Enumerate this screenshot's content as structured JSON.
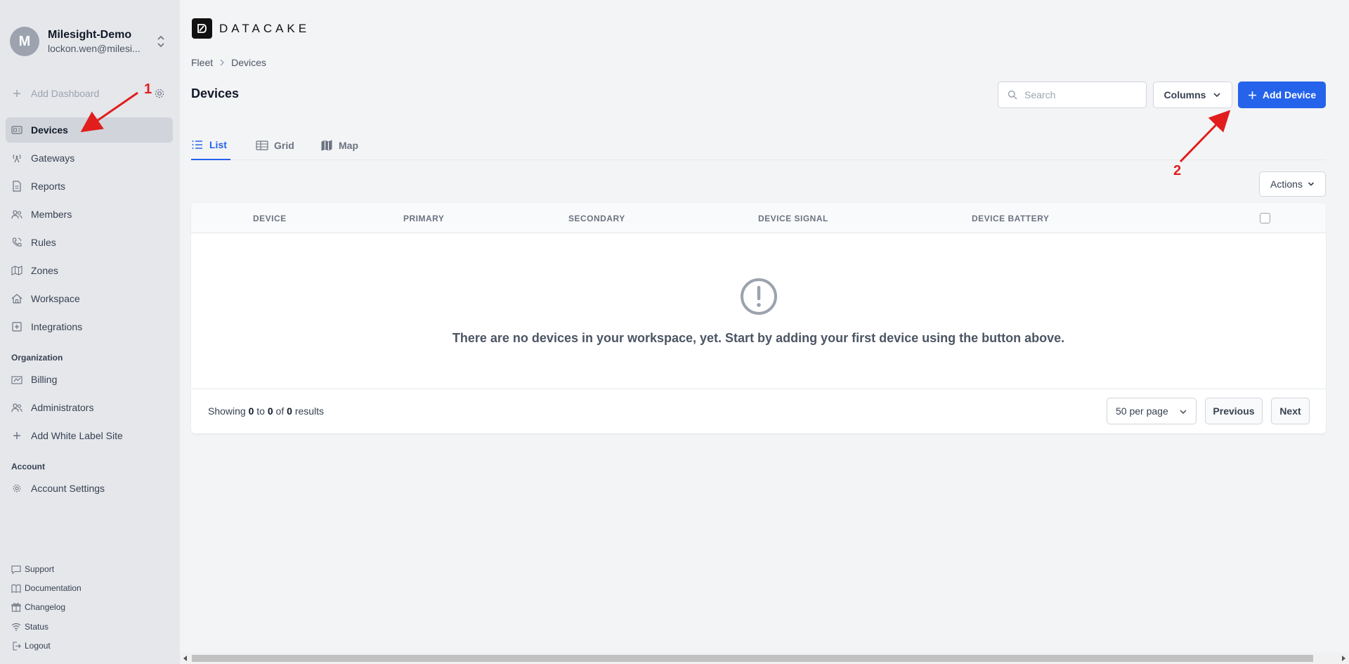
{
  "workspace": {
    "initial": "M",
    "name": "Milesight-Demo",
    "email": "lockon.wen@milesi..."
  },
  "sidebar": {
    "add_dashboard": "Add Dashboard",
    "items": [
      {
        "label": "Devices",
        "icon": "devices-icon"
      },
      {
        "label": "Gateways",
        "icon": "gateway-icon"
      },
      {
        "label": "Reports",
        "icon": "report-icon"
      },
      {
        "label": "Members",
        "icon": "members-icon"
      },
      {
        "label": "Rules",
        "icon": "rules-icon"
      },
      {
        "label": "Zones",
        "icon": "map-icon"
      },
      {
        "label": "Workspace",
        "icon": "home-icon"
      },
      {
        "label": "Integrations",
        "icon": "integrations-icon"
      }
    ],
    "organization_label": "Organization",
    "org_items": [
      {
        "label": "Billing",
        "icon": "billing-icon"
      },
      {
        "label": "Administrators",
        "icon": "administrators-icon"
      },
      {
        "label": "Add White Label Site",
        "icon": "plus-icon"
      }
    ],
    "account_label": "Account",
    "account_items": [
      {
        "label": "Account Settings",
        "icon": "gear-icon"
      }
    ],
    "footer": [
      {
        "label": "Support",
        "icon": "chat-icon"
      },
      {
        "label": "Documentation",
        "icon": "book-icon"
      },
      {
        "label": "Changelog",
        "icon": "gift-icon"
      },
      {
        "label": "Status",
        "icon": "wifi-icon"
      },
      {
        "label": "Logout",
        "icon": "logout-icon"
      }
    ]
  },
  "brand": {
    "name": "DATACAKE"
  },
  "breadcrumb": {
    "parent": "Fleet",
    "current": "Devices"
  },
  "page": {
    "title": "Devices"
  },
  "search": {
    "placeholder": "Search"
  },
  "toolbar": {
    "columns_label": "Columns",
    "add_device_label": "Add Device",
    "actions_label": "Actions"
  },
  "tabs": [
    {
      "label": "List",
      "active": true
    },
    {
      "label": "Grid",
      "active": false
    },
    {
      "label": "Map",
      "active": false
    }
  ],
  "table": {
    "columns": [
      "DEVICE",
      "PRIMARY",
      "SECONDARY",
      "DEVICE SIGNAL",
      "DEVICE BATTERY"
    ],
    "empty_message": "There are no devices in your workspace, yet. Start by adding your first device using the button above."
  },
  "pagination": {
    "showing_prefix": "Showing",
    "from": "0",
    "to_word": "to",
    "to": "0",
    "of_word": "of",
    "total": "0",
    "results_word": "results",
    "per_page": "50 per page",
    "previous_label": "Previous",
    "next_label": "Next"
  },
  "annotations": {
    "marker1": "1",
    "marker2": "2",
    "color": "#e11d1d"
  },
  "colors": {
    "accent": "#2563eb",
    "sidebar_bg": "#e5e7eb",
    "page_bg": "#f3f4f6"
  }
}
